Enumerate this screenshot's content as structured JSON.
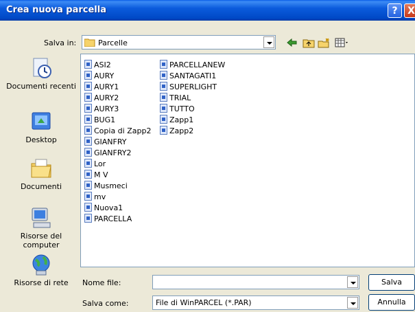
{
  "window": {
    "title": "Crea nuova parcella"
  },
  "titlebar": {
    "help_glyph": "?",
    "close_glyph": "X"
  },
  "save_in": {
    "label": "Salva in:",
    "value": "Parcelle"
  },
  "places": [
    {
      "label": "Documenti recenti",
      "icon": "recent-documents-icon"
    },
    {
      "label": "Desktop",
      "icon": "desktop-icon"
    },
    {
      "label": "Documenti",
      "icon": "documents-icon"
    },
    {
      "label": "Risorse del computer",
      "icon": "my-computer-icon"
    },
    {
      "label": "Risorse di rete",
      "icon": "network-icon"
    }
  ],
  "files": {
    "col1": [
      "ASI2",
      "AURY",
      "AURY1",
      "AURY2",
      "AURY3",
      "BUG1",
      "Copia di Zapp2",
      "GIANFRY",
      "GIANFRY2",
      "Lor",
      "M V",
      "Musmeci",
      "mv",
      "Nuova1",
      "PARCELLA"
    ],
    "col2": [
      "PARCELLANEW",
      "SANTAGATI1",
      "SUPERLIGHT",
      "TRIAL",
      "TUTTO",
      "Zapp1",
      "Zapp2"
    ]
  },
  "filename": {
    "label": "Nome file:",
    "value": ""
  },
  "filetype": {
    "label": "Salva come:",
    "value": "File di WinPARCEL (*.PAR)"
  },
  "buttons": {
    "save": "Salva",
    "cancel": "Annulla"
  }
}
